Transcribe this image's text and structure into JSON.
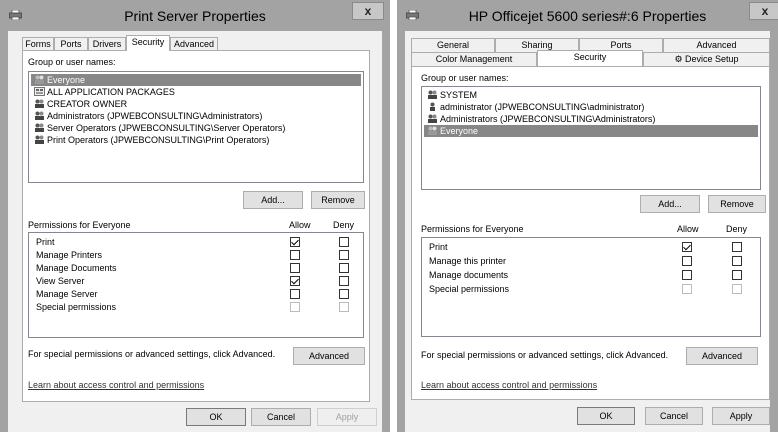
{
  "left": {
    "title": "Print Server Properties",
    "close": "x",
    "tabs": [
      "Forms",
      "Ports",
      "Drivers",
      "Security",
      "Advanced"
    ],
    "group_label": "Group or user names:",
    "users": [
      "Everyone",
      "ALL APPLICATION PACKAGES",
      "CREATOR OWNER",
      "Administrators (JPWEBCONSULTING\\Administrators)",
      "Server Operators (JPWEBCONSULTING\\Server Operators)",
      "Print Operators (JPWEBCONSULTING\\Print Operators)"
    ],
    "add": "Add...",
    "remove": "Remove",
    "perm_label": "Permissions for Everyone",
    "allow": "Allow",
    "deny": "Deny",
    "perms": [
      {
        "name": "Print",
        "allow": true,
        "deny": false
      },
      {
        "name": "Manage Printers",
        "allow": false,
        "deny": false
      },
      {
        "name": "Manage Documents",
        "allow": false,
        "deny": false
      },
      {
        "name": "View Server",
        "allow": true,
        "deny": false
      },
      {
        "name": "Manage Server",
        "allow": false,
        "deny": false
      },
      {
        "name": "Special permissions",
        "allow": false,
        "deny": false
      }
    ],
    "special_text": "For special permissions or advanced settings, click Advanced.",
    "advanced": "Advanced",
    "learn": "Learn about access control and permissions",
    "ok": "OK",
    "cancel": "Cancel",
    "apply": "Apply"
  },
  "right": {
    "title": "HP Officejet 5600 series#:6 Properties",
    "close": "x",
    "tabs_row1": [
      "General",
      "Sharing",
      "Ports",
      "Advanced"
    ],
    "tabs_row2": [
      "Color Management",
      "Security",
      "Device Setup"
    ],
    "group_label": "Group or user names:",
    "users": [
      "SYSTEM",
      "administrator (JPWEBCONSULTING\\administrator)",
      "Administrators (JPWEBCONSULTING\\Administrators)",
      "Everyone"
    ],
    "add": "Add...",
    "remove": "Remove",
    "perm_label": "Permissions for Everyone",
    "allow": "Allow",
    "deny": "Deny",
    "perms": [
      {
        "name": "Print",
        "allow": true,
        "deny": false
      },
      {
        "name": "Manage this printer",
        "allow": false,
        "deny": false
      },
      {
        "name": "Manage documents",
        "allow": false,
        "deny": false
      },
      {
        "name": "Special permissions",
        "allow": false,
        "deny": false
      }
    ],
    "special_text": "For special permissions or advanced settings, click Advanced.",
    "advanced": "Advanced",
    "learn": "Learn about access control and permissions",
    "ok": "OK",
    "cancel": "Cancel",
    "apply": "Apply"
  }
}
